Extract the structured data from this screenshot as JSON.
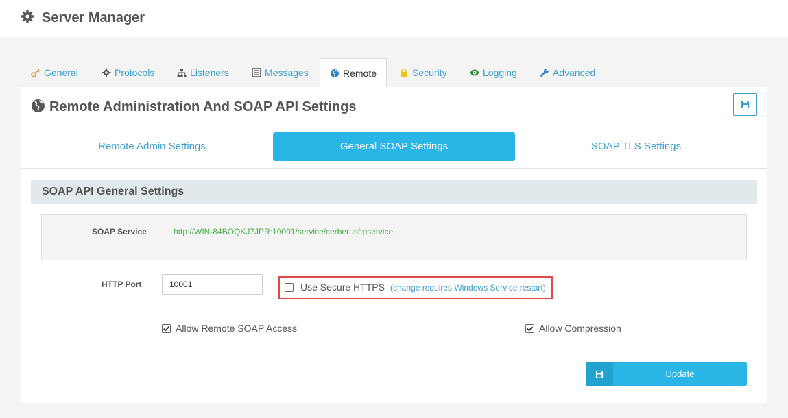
{
  "app": {
    "title": "Server Manager"
  },
  "tabs": [
    {
      "label": "General",
      "icon": "key-icon"
    },
    {
      "label": "Protocols",
      "icon": "gear-icon"
    },
    {
      "label": "Listeners",
      "icon": "sitemap-icon"
    },
    {
      "label": "Messages",
      "icon": "list-icon"
    },
    {
      "label": "Remote",
      "icon": "globe-icon",
      "active": true
    },
    {
      "label": "Security",
      "icon": "lock-icon"
    },
    {
      "label": "Logging",
      "icon": "eye-icon"
    },
    {
      "label": "Advanced",
      "icon": "wrench-icon"
    }
  ],
  "page": {
    "heading": "Remote Administration And SOAP API Settings"
  },
  "subtabs": [
    {
      "label": "Remote Admin Settings"
    },
    {
      "label": "General SOAP Settings",
      "active": true
    },
    {
      "label": "SOAP TLS Settings"
    }
  ],
  "section": {
    "title": "SOAP API General Settings"
  },
  "soap_service": {
    "label": "SOAP Service",
    "url": "http://WIN-84BOQKJ7JPR:10001/service/cerberusftpservice"
  },
  "http_port": {
    "label": "HTTP Port",
    "value": "10001"
  },
  "https": {
    "label": "Use Secure HTTPS",
    "note": "(change requires Windows Service restart)",
    "checked": false
  },
  "options": {
    "remote_soap": {
      "label": "Allow Remote SOAP Access",
      "checked": true
    },
    "compression": {
      "label": "Allow Compression",
      "checked": true
    }
  },
  "update_button": {
    "label": "Update"
  },
  "colors": {
    "accent": "#29b6e6",
    "link": "#3a9fd1",
    "url_green": "#4cae4c",
    "highlight_red": "#e04a4a"
  }
}
